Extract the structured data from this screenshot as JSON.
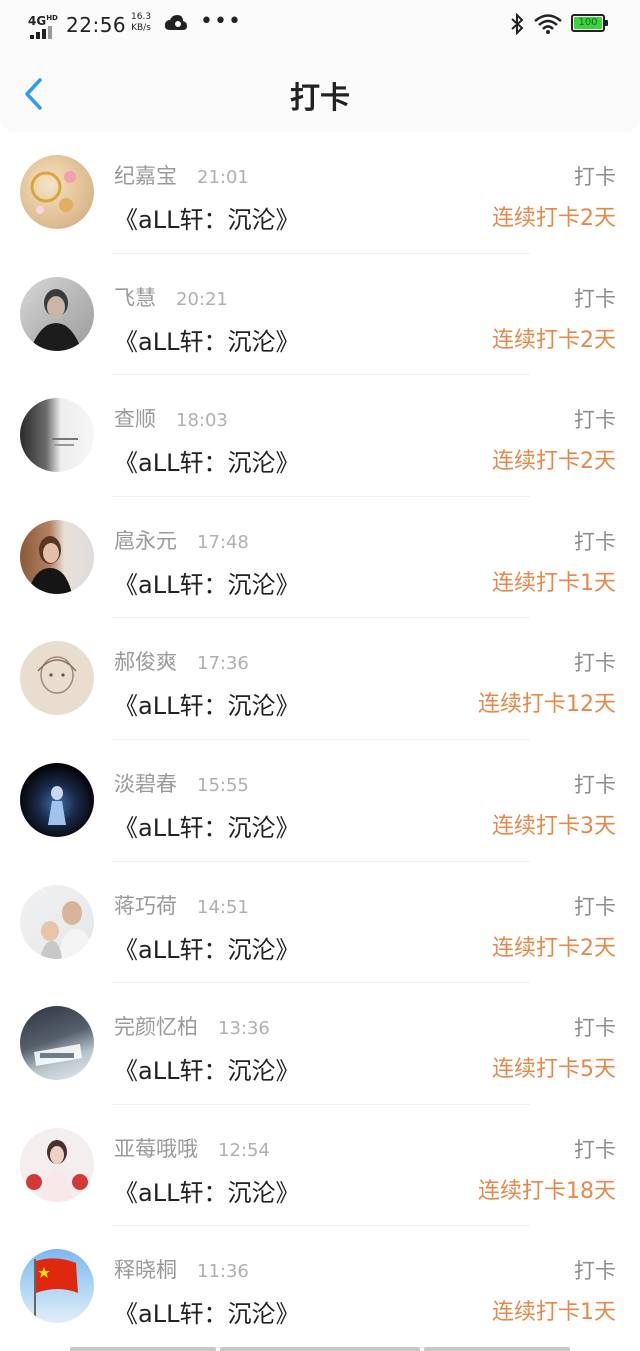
{
  "status_bar": {
    "network": "4G",
    "network_sup": "HD",
    "time": "22:56",
    "speed_value": "16.3",
    "speed_unit": "KB/s",
    "more": "•••",
    "battery": "100",
    "battery_color": "#3ed140"
  },
  "nav": {
    "back_icon": "chevron-left-icon",
    "title": "打卡"
  },
  "colors": {
    "accent": "#2e9cf0",
    "streak": "#e8874a"
  },
  "list": {
    "items": [
      {
        "name": "纪嘉宝",
        "time": "21:01",
        "book": "《aLL轩：沉沦》",
        "action": "打卡",
        "streak": "连续打卡2天",
        "avatar": "jewelry-photo"
      },
      {
        "name": "飞慧",
        "time": "20:21",
        "book": "《aLL轩：沉沦》",
        "action": "打卡",
        "streak": "连续打卡2天",
        "avatar": "man-portrait"
      },
      {
        "name": "查顺",
        "time": "18:03",
        "book": "《aLL轩：沉沦》",
        "action": "打卡",
        "streak": "连续打卡2天",
        "avatar": "grayscale-portrait"
      },
      {
        "name": "扈永元",
        "time": "17:48",
        "book": "《aLL轩：沉沦》",
        "action": "打卡",
        "streak": "连续打卡1天",
        "avatar": "woman-photo"
      },
      {
        "name": "郝俊爽",
        "time": "17:36",
        "book": "《aLL轩：沉沦》",
        "action": "打卡",
        "streak": "连续打卡12天",
        "avatar": "sketch-drawing"
      },
      {
        "name": "淡碧春",
        "time": "15:55",
        "book": "《aLL轩：沉沦》",
        "action": "打卡",
        "streak": "连续打卡3天",
        "avatar": "stage-performer"
      },
      {
        "name": "蒋巧荷",
        "time": "14:51",
        "book": "《aLL轩：沉沦》",
        "action": "打卡",
        "streak": "连续打卡2天",
        "avatar": "father-child-photo"
      },
      {
        "name": "完颜忆柏",
        "time": "13:36",
        "book": "《aLL轩：沉沦》",
        "action": "打卡",
        "streak": "连续打卡5天",
        "avatar": "text-art"
      },
      {
        "name": "亚莓哦哦",
        "time": "12:54",
        "book": "《aLL轩：沉沦》",
        "action": "打卡",
        "streak": "连续打卡18天",
        "avatar": "boxer-photo"
      },
      {
        "name": "释晓桐",
        "time": "11:36",
        "book": "《aLL轩：沉沦》",
        "action": "打卡",
        "streak": "连续打卡1天",
        "avatar": "flag-photo"
      }
    ]
  }
}
